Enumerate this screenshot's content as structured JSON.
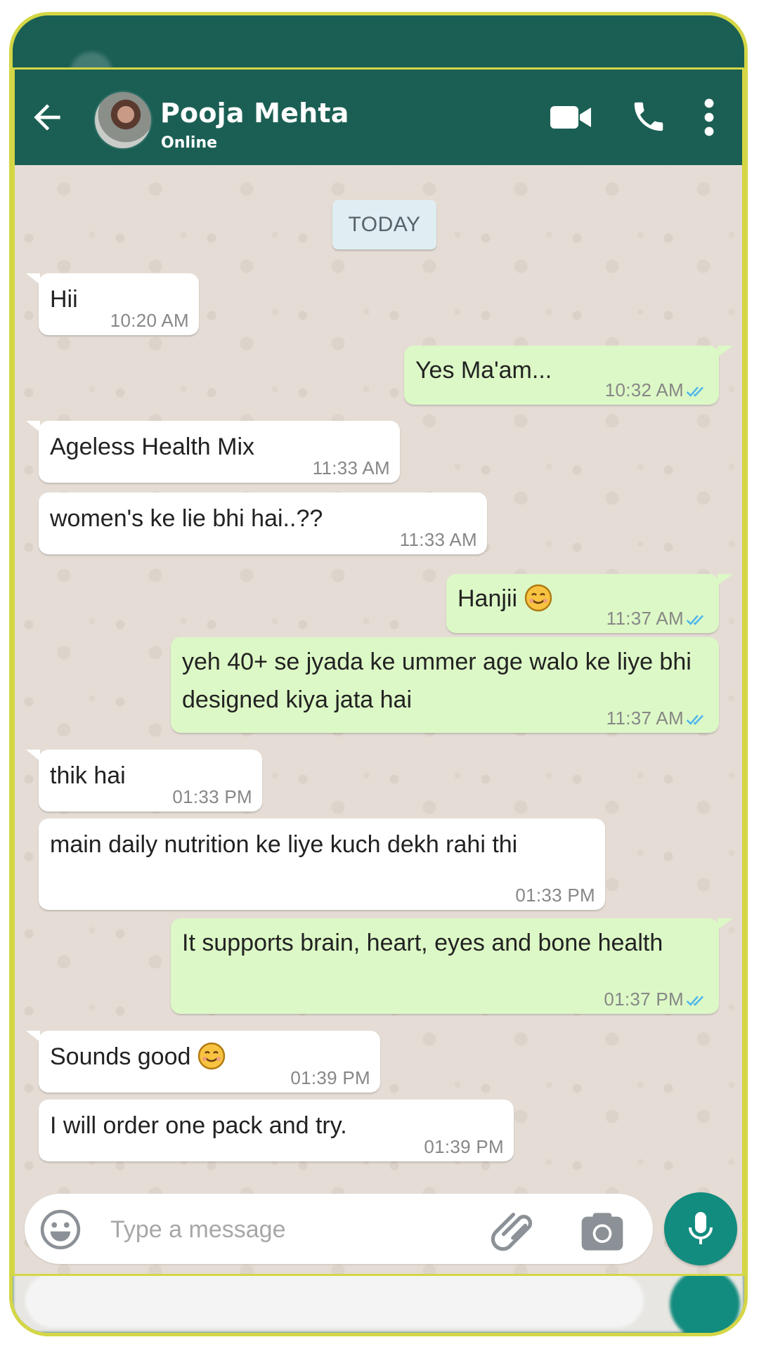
{
  "header": {
    "contact_name": "Pooja Mehta",
    "status": "Online",
    "icons": [
      "back-arrow-icon",
      "avatar",
      "video-call-icon",
      "phone-call-icon",
      "more-vertical-icon"
    ]
  },
  "date_separator": "TODAY",
  "messages": [
    {
      "direction": "incoming",
      "text": "Hii",
      "time": "10:20 AM"
    },
    {
      "direction": "outgoing",
      "text": "Yes Ma'am...",
      "time": "10:32 AM",
      "read": true
    },
    {
      "direction": "incoming",
      "text": "Ageless Health Mix",
      "time": "11:33 AM"
    },
    {
      "direction": "incoming",
      "text": "women's ke lie bhi hai..??",
      "time": "11:33 AM"
    },
    {
      "direction": "outgoing",
      "text": "Hanjii",
      "emoji": "smiling-face",
      "time": "11:37 AM",
      "read": true
    },
    {
      "direction": "outgoing",
      "text": "yeh 40+ se jyada ke ummer age walo ke liye bhi designed kiya jata hai",
      "time": "11:37 AM",
      "read": true
    },
    {
      "direction": "incoming",
      "text": "thik hai",
      "time": "01:33 PM"
    },
    {
      "direction": "incoming",
      "text": "main daily nutrition ke liye kuch dekh rahi thi",
      "time": "01:33 PM"
    },
    {
      "direction": "outgoing",
      "text": "It supports brain, heart, eyes and bone health",
      "time": "01:37 PM",
      "read": true
    },
    {
      "direction": "incoming",
      "text": "Sounds good",
      "emoji": "smiling-face",
      "time": "01:39 PM"
    },
    {
      "direction": "incoming",
      "text": "I will order one pack and try.",
      "time": "01:39 PM"
    }
  ],
  "composer": {
    "placeholder": "Type a message",
    "value": ""
  },
  "colors": {
    "header": "#1b5f54",
    "chat_background": "#e5ddd5",
    "incoming_bubble": "#ffffff",
    "outgoing_bubble": "#dcf8c6",
    "read_ticks": "#4fb6ec",
    "mic_button": "#128c7e",
    "frame_border": "#d4d646"
  }
}
